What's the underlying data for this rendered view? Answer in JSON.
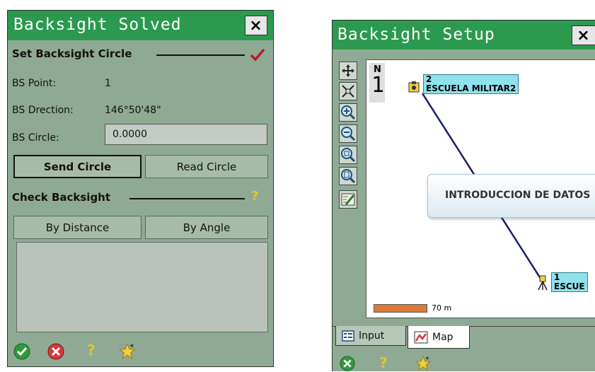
{
  "left": {
    "title": "Backsight Solved",
    "close": "×",
    "set_section": "Set Backsight Circle",
    "bs_point_label": "BS Point:",
    "bs_point_value": "1",
    "bs_direction_label": "BS Drection:",
    "bs_direction_value": "146°50'48\"",
    "bs_circle_label": "BS Circle:",
    "bs_circle_value": "0.0000",
    "send_circle": "Send Circle",
    "read_circle": "Read Circle",
    "check_section": "Check Backsight",
    "by_distance": "By Distance",
    "by_angle": "By Angle"
  },
  "right": {
    "title": "Backsight Setup",
    "close": "×",
    "north_letter": "N",
    "north_number": "1",
    "point2_number": "2",
    "point2_name": "ESCUELA MILITAR2",
    "point1_number": "1",
    "point1_name": "ESCUE",
    "callout": "INTRODUCCION DE DATOS",
    "scale_label": "70 m",
    "tabs": [
      "Input",
      "Map"
    ]
  },
  "colors": {
    "panel_bg": "#8faa94",
    "title_bar": "#2b9a4e",
    "line": "#1d1d6e",
    "label_bg": "#8fe3ec",
    "scale_bar": "#e07b39"
  }
}
